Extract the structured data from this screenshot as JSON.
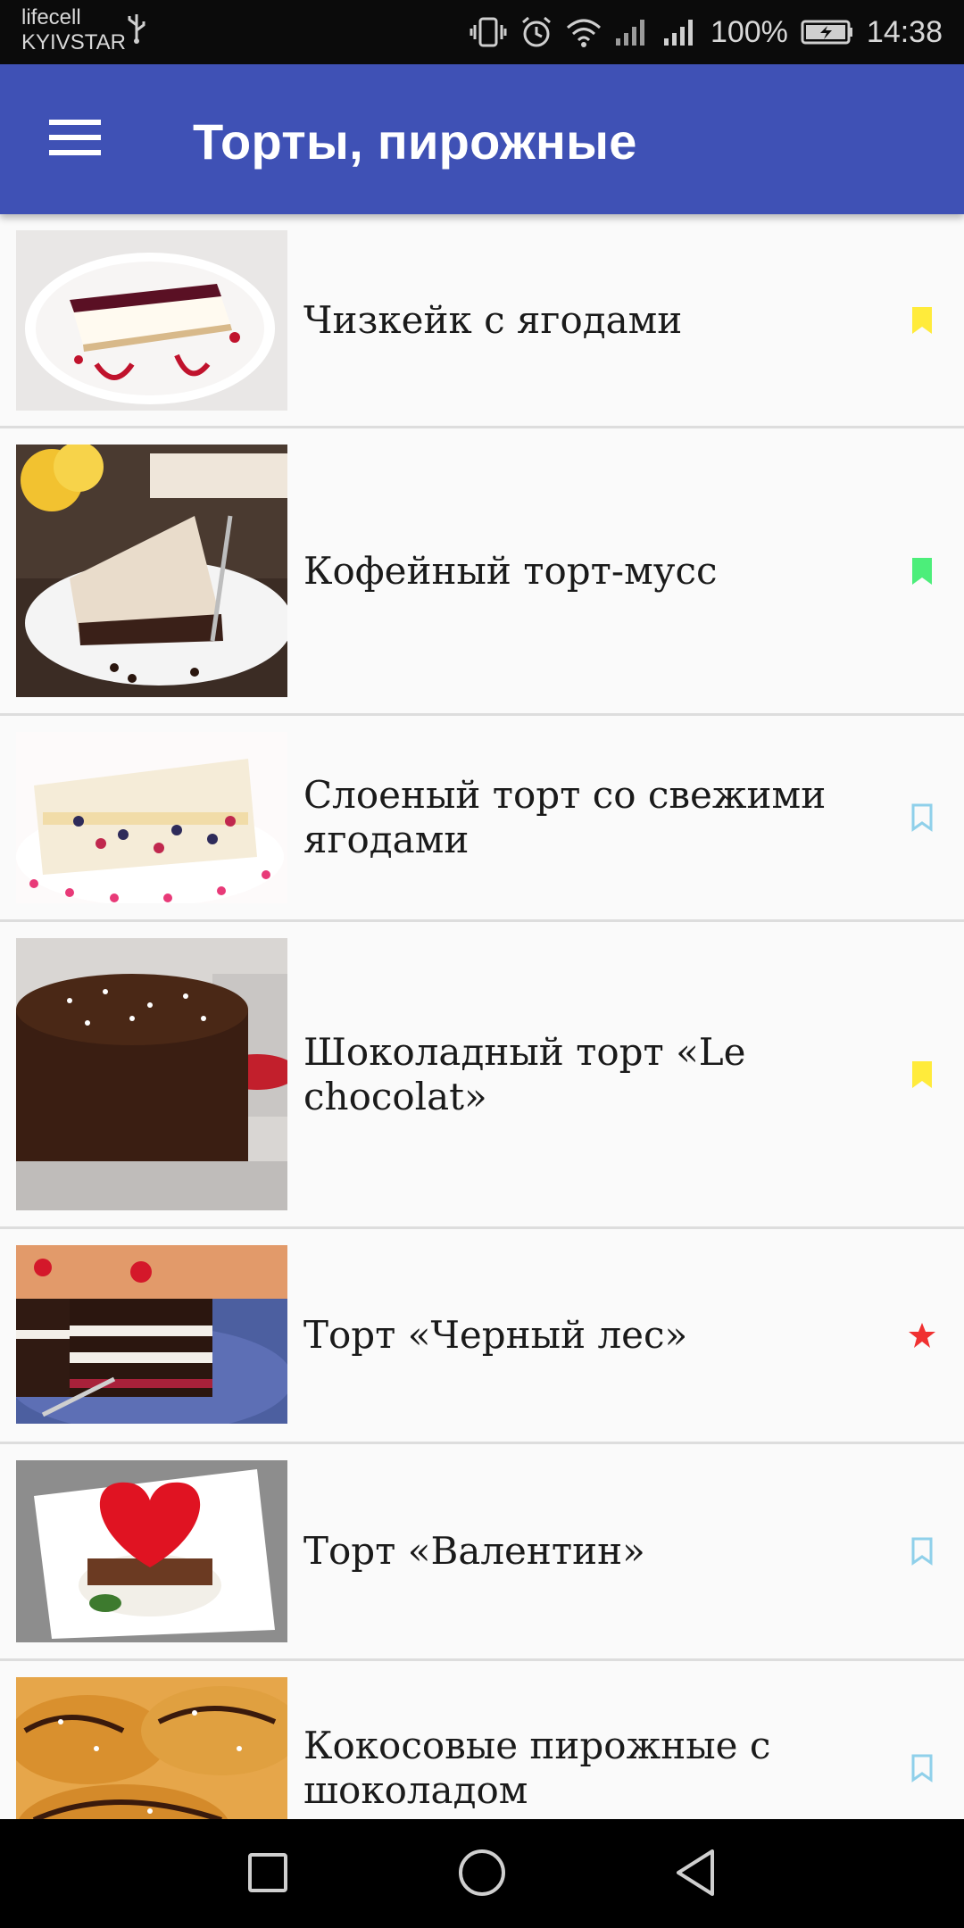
{
  "status_bar": {
    "carrier_line1": "lifecell",
    "carrier_line2": "KYIVSTAR",
    "battery_percent": "100%",
    "time": "14:38",
    "icons": [
      "usb-icon",
      "vibrate-icon",
      "alarm-icon",
      "wifi-icon",
      "signal-icon",
      "signal-icon",
      "battery-charging-icon"
    ]
  },
  "app_bar": {
    "title": "Торты, пирожные",
    "menu_icon": "hamburger-menu-icon",
    "color": "#3f51b5"
  },
  "recipes": [
    {
      "title": "Чизкейк с ягодами",
      "marker": "bookmark",
      "marker_color": "#ffeb3b",
      "marker_filled": true
    },
    {
      "title": "Кофейный торт-мусс",
      "marker": "bookmark",
      "marker_color": "#4cee7a",
      "marker_filled": true
    },
    {
      "title": "Слоеный торт со свежими ягодами",
      "marker": "bookmark",
      "marker_color": "#8fd0ea",
      "marker_filled": false
    },
    {
      "title": "Шоколадный торт «Le chocolat»",
      "marker": "bookmark",
      "marker_color": "#ffeb3b",
      "marker_filled": true
    },
    {
      "title": "Торт «Черный лес»",
      "marker": "star",
      "marker_color": "#f03030",
      "marker_filled": true
    },
    {
      "title": "Торт «Валентин»",
      "marker": "bookmark",
      "marker_color": "#8fd0ea",
      "marker_filled": false
    },
    {
      "title": "Кокосовые пирожные с шоколадом",
      "marker": "bookmark",
      "marker_color": "#8fd0ea",
      "marker_filled": false
    }
  ],
  "nav_bar": {
    "icons": [
      "recents-square-icon",
      "home-circle-icon",
      "back-triangle-icon"
    ]
  }
}
